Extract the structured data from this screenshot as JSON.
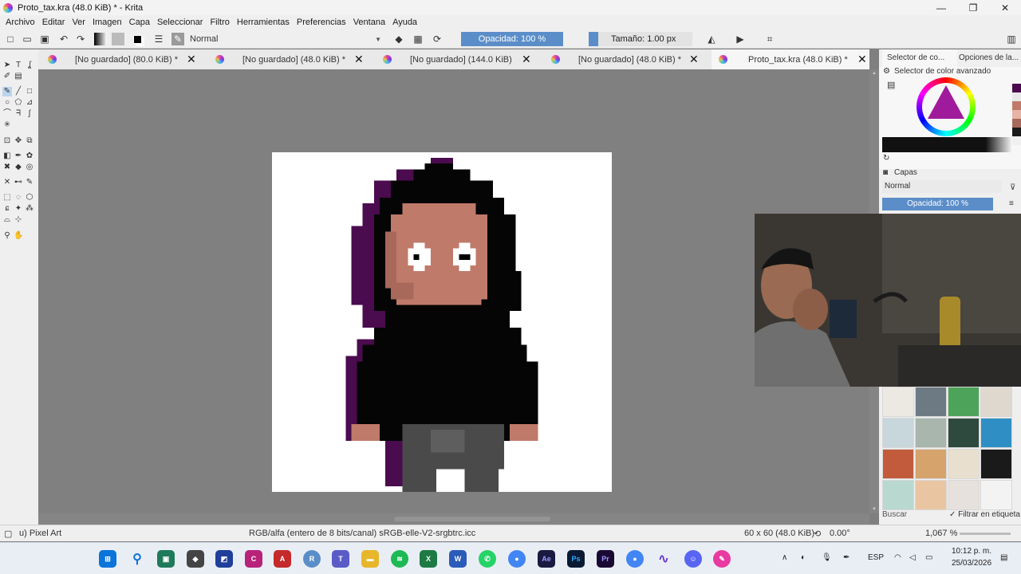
{
  "window": {
    "title": "Proto_tax.kra (48.0 KiB) * - Krita",
    "minimize": "—",
    "maximize": "❐",
    "close": "✕"
  },
  "menu": [
    "Archivo",
    "Editar",
    "Ver",
    "Imagen",
    "Capa",
    "Seleccionar",
    "Filtro",
    "Herramientas",
    "Preferencias",
    "Ventana",
    "Ayuda"
  ],
  "toolbar": {
    "blend_mode": "Normal",
    "opacity_label": "Opacidad: 100 %",
    "size_label": "Tamaño: 1.00 px"
  },
  "tabs": [
    {
      "label": "[No guardado]  (80.0 KiB) *",
      "close": "✕"
    },
    {
      "label": "[No guardado]  (48.0 KiB) *",
      "close": "✕"
    },
    {
      "label": "[No guardado]  (144.0 KiB)",
      "close": "✕"
    },
    {
      "label": "[No guardado]  (48.0 KiB) *",
      "close": "✕"
    },
    {
      "label": "Proto_tax.kra (48.0 KiB) *",
      "close": "✕"
    }
  ],
  "dock": {
    "tab_color": "Selector de co...",
    "tab_options": "Opciones de la...",
    "color_panel_title": "Selector de color avanzado",
    "layers_title": "Capas",
    "layer_blend": "Normal",
    "layer_opacity": "Opacidad: 100 %",
    "brush_search": "Buscar",
    "brush_filter": "Filtrar en etiqueta"
  },
  "status": {
    "preset": "u) Pixel Art",
    "color_space": "RGB/alfa (entero de 8 bits/canal)  sRGB-elle-V2-srgbtrc.icc",
    "image_size": "60 x 60 (48.0 KiB)",
    "rotation": "0.00°",
    "zoom": "1,067 %"
  },
  "tray": {
    "language": "ESP",
    "time": "10:12 p. m.",
    "date": "25/03/2026"
  },
  "colors": {
    "accent": "#5b8ec8",
    "hoodie_black": "#050505",
    "hoodie_purple": "#4a0b4f",
    "skin": "#c07a6a",
    "skin_shadow": "#a8685a",
    "pants": "#4a4a4a",
    "pants_light": "#5e5e5e"
  },
  "icons": [
    "new-file-icon",
    "open-icon",
    "save-icon",
    "undo-icon",
    "redo-icon",
    "eraser-icon",
    "alpha-lock-icon",
    "reload-icon",
    "mirror-icon",
    "wrap-icon"
  ]
}
